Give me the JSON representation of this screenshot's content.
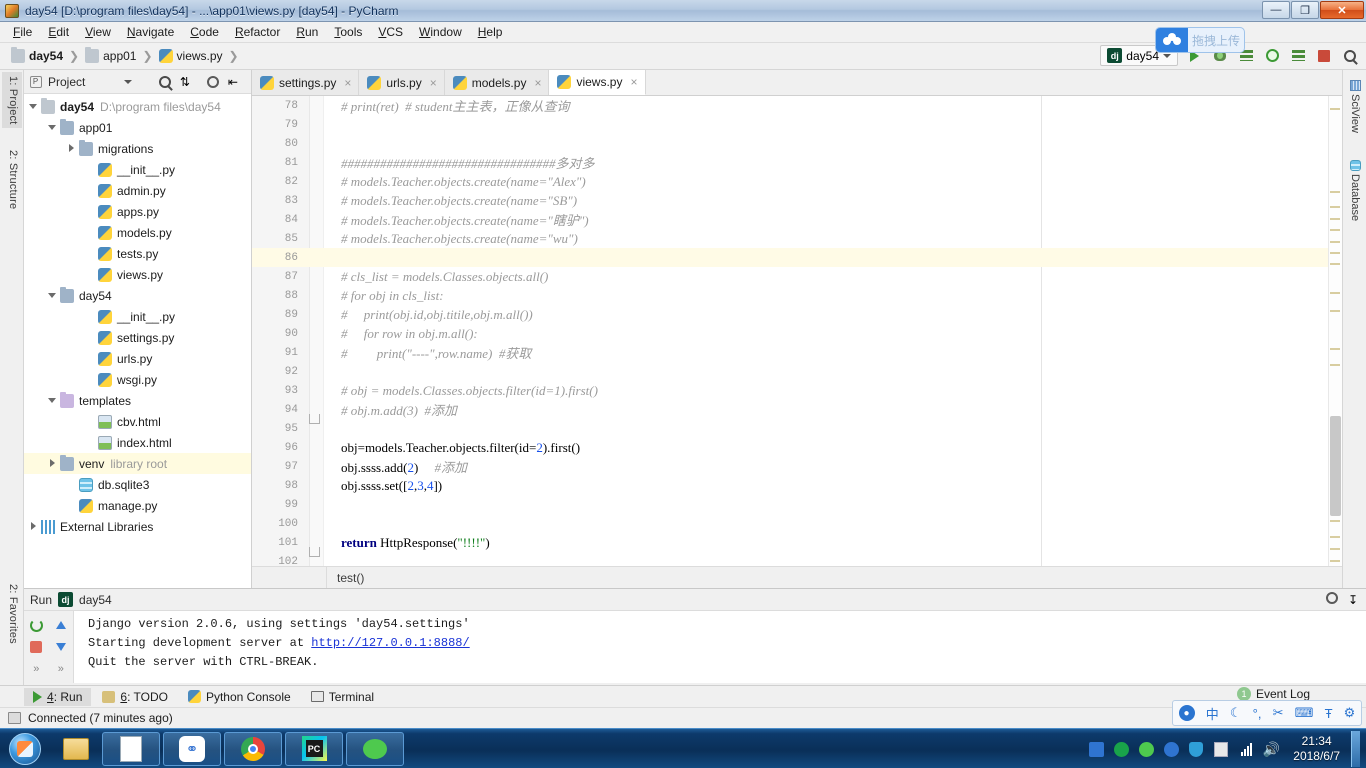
{
  "window": {
    "title": "day54 [D:\\program files\\day54] - ...\\app01\\views.py [day54] - PyCharm",
    "minimize_label": "—",
    "maximize_label": "❐",
    "close_label": "✕"
  },
  "menubar": {
    "items": [
      "File",
      "Edit",
      "View",
      "Navigate",
      "Code",
      "Refactor",
      "Run",
      "Tools",
      "VCS",
      "Window",
      "Help"
    ]
  },
  "breadcrumbs": {
    "items": [
      {
        "label": "day54",
        "icon": "folder-icon",
        "bold": true
      },
      {
        "label": "app01",
        "icon": "folder-icon",
        "bold": false
      },
      {
        "label": "views.py",
        "icon": "python-file-icon",
        "bold": false
      }
    ],
    "separator": "❯"
  },
  "toolbar": {
    "run_config": "day54",
    "run_config_icon": "django-icon",
    "dropdown_caret": "▾",
    "buttons": [
      {
        "name": "run-button",
        "icon": "run-icon"
      },
      {
        "name": "debug-button",
        "icon": "debug-icon"
      },
      {
        "name": "run-coverage-button",
        "icon": "coverage-icon"
      },
      {
        "name": "run-with-profiler-button",
        "icon": "profiler-icon"
      },
      {
        "name": "attach-button",
        "icon": "attach-icon"
      },
      {
        "name": "stop-button",
        "icon": "stop-icon"
      },
      {
        "name": "search-everywhere-button",
        "icon": "search-icon"
      }
    ]
  },
  "upload_widget": {
    "label": "拖拽上传",
    "icon": "baidu-cloud-icon"
  },
  "left_strip": {
    "tabs": [
      {
        "label": "1: Project",
        "selected": true,
        "underline": "1"
      },
      {
        "label": "2: Structure",
        "selected": false,
        "underline": "2"
      }
    ],
    "bottom_tab": "2: Favorites"
  },
  "right_strip": {
    "tabs": [
      {
        "label": "SciView",
        "icon": "sciview-icon"
      },
      {
        "label": "Database",
        "icon": "database-icon"
      }
    ]
  },
  "project_panel": {
    "header_label": "Project",
    "header_icons": [
      "project-view-icon",
      "collapse-caret-icon",
      "locate-icon",
      "collapse-all-icon",
      "settings-gear-icon",
      "hide-icon"
    ],
    "tree": [
      {
        "indent": 0,
        "arrow": "down",
        "icon": "folder-icon",
        "label": "day54",
        "bold": true,
        "sub": "D:\\program files\\day54",
        "highlight": false
      },
      {
        "indent": 1,
        "arrow": "down",
        "icon": "folder-blue-icon",
        "label": "app01",
        "bold": false,
        "sub": "",
        "highlight": false
      },
      {
        "indent": 2,
        "arrow": "right",
        "icon": "folder-blue-icon",
        "label": "migrations",
        "bold": false,
        "sub": "",
        "highlight": false
      },
      {
        "indent": 3,
        "arrow": "none",
        "icon": "python-file-icon",
        "label": "__init__.py",
        "bold": false,
        "sub": "",
        "highlight": false
      },
      {
        "indent": 3,
        "arrow": "none",
        "icon": "python-file-icon",
        "label": "admin.py",
        "bold": false,
        "sub": "",
        "highlight": false
      },
      {
        "indent": 3,
        "arrow": "none",
        "icon": "python-file-icon",
        "label": "apps.py",
        "bold": false,
        "sub": "",
        "highlight": false
      },
      {
        "indent": 3,
        "arrow": "none",
        "icon": "python-file-icon",
        "label": "models.py",
        "bold": false,
        "sub": "",
        "highlight": false
      },
      {
        "indent": 3,
        "arrow": "none",
        "icon": "python-file-icon",
        "label": "tests.py",
        "bold": false,
        "sub": "",
        "highlight": false
      },
      {
        "indent": 3,
        "arrow": "none",
        "icon": "python-file-icon",
        "label": "views.py",
        "bold": false,
        "sub": "",
        "highlight": false
      },
      {
        "indent": 1,
        "arrow": "down",
        "icon": "folder-blue-icon",
        "label": "day54",
        "bold": false,
        "sub": "",
        "highlight": false
      },
      {
        "indent": 3,
        "arrow": "none",
        "icon": "python-file-icon",
        "label": "__init__.py",
        "bold": false,
        "sub": "",
        "highlight": false
      },
      {
        "indent": 3,
        "arrow": "none",
        "icon": "python-file-icon",
        "label": "settings.py",
        "bold": false,
        "sub": "",
        "highlight": false
      },
      {
        "indent": 3,
        "arrow": "none",
        "icon": "python-file-icon",
        "label": "urls.py",
        "bold": false,
        "sub": "",
        "highlight": false
      },
      {
        "indent": 3,
        "arrow": "none",
        "icon": "python-file-icon",
        "label": "wsgi.py",
        "bold": false,
        "sub": "",
        "highlight": false
      },
      {
        "indent": 1,
        "arrow": "down",
        "icon": "folder-purple-icon",
        "label": "templates",
        "bold": false,
        "sub": "",
        "highlight": false
      },
      {
        "indent": 3,
        "arrow": "none",
        "icon": "html-file-icon",
        "label": "cbv.html",
        "bold": false,
        "sub": "",
        "highlight": false
      },
      {
        "indent": 3,
        "arrow": "none",
        "icon": "html-file-icon",
        "label": "index.html",
        "bold": false,
        "sub": "",
        "highlight": false
      },
      {
        "indent": 1,
        "arrow": "right",
        "icon": "folder-blue-icon",
        "label": "venv",
        "bold": false,
        "sub": "library root",
        "highlight": true
      },
      {
        "indent": 2,
        "arrow": "none",
        "icon": "database-icon",
        "label": "db.sqlite3",
        "bold": false,
        "sub": "",
        "highlight": false
      },
      {
        "indent": 2,
        "arrow": "none",
        "icon": "python-file-icon",
        "label": "manage.py",
        "bold": false,
        "sub": "",
        "highlight": false
      },
      {
        "indent": 0,
        "arrow": "right",
        "icon": "library-icon",
        "label": "External Libraries",
        "bold": false,
        "sub": "",
        "highlight": false
      }
    ]
  },
  "editor": {
    "tabs": [
      {
        "label": "settings.py",
        "icon": "python-file-icon",
        "active": false,
        "close": "×"
      },
      {
        "label": "urls.py",
        "icon": "python-file-icon",
        "active": false,
        "close": "×"
      },
      {
        "label": "models.py",
        "icon": "python-file-icon",
        "active": false,
        "close": "×"
      },
      {
        "label": "views.py",
        "icon": "python-file-icon",
        "active": true,
        "close": "×"
      }
    ],
    "first_line_number": 78,
    "current_line": 86,
    "lines": [
      {
        "n": 78,
        "fold": false,
        "tokens": [
          {
            "t": "    # print(ret)  # student主主表，正像从查询",
            "c": "cm"
          }
        ]
      },
      {
        "n": 79,
        "fold": false,
        "tokens": []
      },
      {
        "n": 80,
        "fold": false,
        "tokens": []
      },
      {
        "n": 81,
        "fold": false,
        "tokens": [
          {
            "t": "    #################################多对多",
            "c": "cm"
          }
        ]
      },
      {
        "n": 82,
        "fold": false,
        "tokens": [
          {
            "t": "    # models.Teacher.objects.create(name=\"Alex\")",
            "c": "cm"
          }
        ]
      },
      {
        "n": 83,
        "fold": false,
        "tokens": [
          {
            "t": "    # models.Teacher.objects.create(name=\"SB\")",
            "c": "cm"
          }
        ]
      },
      {
        "n": 84,
        "fold": false,
        "tokens": [
          {
            "t": "    # models.Teacher.objects.create(name=\"瞎驴\")",
            "c": "cm"
          }
        ]
      },
      {
        "n": 85,
        "fold": false,
        "tokens": [
          {
            "t": "    # models.Teacher.objects.create(name=\"wu\")",
            "c": "cm"
          }
        ]
      },
      {
        "n": 86,
        "fold": false,
        "tokens": []
      },
      {
        "n": 87,
        "fold": false,
        "tokens": [
          {
            "t": "    # cls_list = models.Classes.objects.all()",
            "c": "cm"
          }
        ]
      },
      {
        "n": 88,
        "fold": false,
        "tokens": [
          {
            "t": "    # for obj in cls_list:",
            "c": "cm"
          }
        ]
      },
      {
        "n": 89,
        "fold": false,
        "tokens": [
          {
            "t": "    #     print(obj.id,obj.titile,obj.m.all())",
            "c": "cm"
          }
        ]
      },
      {
        "n": 90,
        "fold": false,
        "tokens": [
          {
            "t": "    #     for row in obj.m.all():",
            "c": "cm"
          }
        ]
      },
      {
        "n": 91,
        "fold": false,
        "tokens": [
          {
            "t": "    #         print(\"----\",row.name)  #获取",
            "c": "cm"
          }
        ]
      },
      {
        "n": 92,
        "fold": false,
        "tokens": []
      },
      {
        "n": 93,
        "fold": false,
        "tokens": [
          {
            "t": "    # obj = models.Classes.objects.filter(id=1).first()",
            "c": "cm"
          }
        ]
      },
      {
        "n": 94,
        "fold": true,
        "tokens": [
          {
            "t": "    # obj.m.add(3)  #添加",
            "c": "cm"
          }
        ]
      },
      {
        "n": 95,
        "fold": false,
        "tokens": []
      },
      {
        "n": 96,
        "fold": false,
        "tokens": [
          {
            "t": "    obj=models.Teacher.objects.filter(id=",
            "c": ""
          },
          {
            "t": "2",
            "c": "num"
          },
          {
            "t": ").first()",
            "c": ""
          }
        ]
      },
      {
        "n": 97,
        "fold": false,
        "tokens": [
          {
            "t": "    obj.ssss.add(",
            "c": ""
          },
          {
            "t": "2",
            "c": "num"
          },
          {
            "t": ")     ",
            "c": ""
          },
          {
            "t": "#添加",
            "c": "cm"
          }
        ]
      },
      {
        "n": 98,
        "fold": false,
        "tokens": [
          {
            "t": "    obj.ssss.set([",
            "c": ""
          },
          {
            "t": "2",
            "c": "num"
          },
          {
            "t": ",",
            "c": ""
          },
          {
            "t": "3",
            "c": "num"
          },
          {
            "t": ",",
            "c": ""
          },
          {
            "t": "4",
            "c": "num"
          },
          {
            "t": "])",
            "c": ""
          }
        ]
      },
      {
        "n": 99,
        "fold": false,
        "tokens": []
      },
      {
        "n": 100,
        "fold": false,
        "tokens": []
      },
      {
        "n": 101,
        "fold": true,
        "tokens": [
          {
            "t": "    return",
            "c": "kw"
          },
          {
            "t": " HttpResponse(",
            "c": ""
          },
          {
            "t": "\"!!!!\"",
            "c": "str"
          },
          {
            "t": ")",
            "c": ""
          }
        ]
      },
      {
        "n": 102,
        "fold": false,
        "tokens": []
      }
    ],
    "bottom_breadcrumb": "test()"
  },
  "run_window": {
    "title": "Run",
    "config_name": "day54",
    "config_icon": "django-icon",
    "console_lines": [
      {
        "text": "Django version 2.0.6, using settings 'day54.settings'",
        "link": ""
      },
      {
        "pre": "Starting development server at ",
        "link": "http://127.0.0.1:8888/",
        "post": ""
      },
      {
        "text": "Quit the server with CTRL-BREAK.",
        "link": ""
      }
    ],
    "tool_buttons": [
      "rerun-icon",
      "stop-icon",
      "scroll-up-icon",
      "scroll-down-icon",
      "expand-icon",
      "collapse-icon"
    ],
    "header_right_icons": [
      "settings-gear-icon",
      "pin-icon"
    ]
  },
  "bottom_tabs": {
    "items": [
      {
        "label": "4: Run",
        "underline": "4",
        "icon": "run-icon",
        "selected": true
      },
      {
        "label": "6: TODO",
        "underline": "6",
        "icon": "todo-icon",
        "selected": false
      },
      {
        "label": "Python Console",
        "underline": "",
        "icon": "python-file-icon",
        "selected": false
      },
      {
        "label": "Terminal",
        "underline": "",
        "icon": "terminal-icon",
        "selected": false
      }
    ],
    "event_log": {
      "label": "Event Log",
      "badge": "1"
    }
  },
  "statusbar": {
    "text": "Connected (7 minutes ago)",
    "icon": "connection-icon"
  },
  "ime_bar": {
    "icons": [
      "sogou-logo-icon",
      "chinese-mode-icon",
      "moon-icon",
      "punctuation-icon",
      "screenshot-icon",
      "keyboard-icon",
      "skin-icon",
      "settings-gear-icon"
    ],
    "labels": [
      "",
      "中",
      "☾",
      "°,",
      "✂",
      "⌨",
      "Ŧ",
      "⚙"
    ]
  },
  "taskbar": {
    "start_label": "Start",
    "quick_launch": [
      {
        "name": "file-explorer-icon"
      },
      {
        "name": "notepad-icon"
      }
    ],
    "items": [
      {
        "name": "baidu-netdisk-icon"
      },
      {
        "name": "chrome-icon"
      },
      {
        "name": "pycharm-icon"
      },
      {
        "name": "wechat-icon"
      }
    ],
    "tray": [
      {
        "name": "user-account-icon"
      },
      {
        "name": "edge-icon"
      },
      {
        "name": "wechat-tray-icon"
      },
      {
        "name": "baidu-tray-icon"
      },
      {
        "name": "shield-icon"
      },
      {
        "name": "safe-icon"
      },
      {
        "name": "network-icon"
      },
      {
        "name": "volume-icon"
      }
    ],
    "clock_time": "21:34",
    "clock_date": "2018/6/7"
  }
}
